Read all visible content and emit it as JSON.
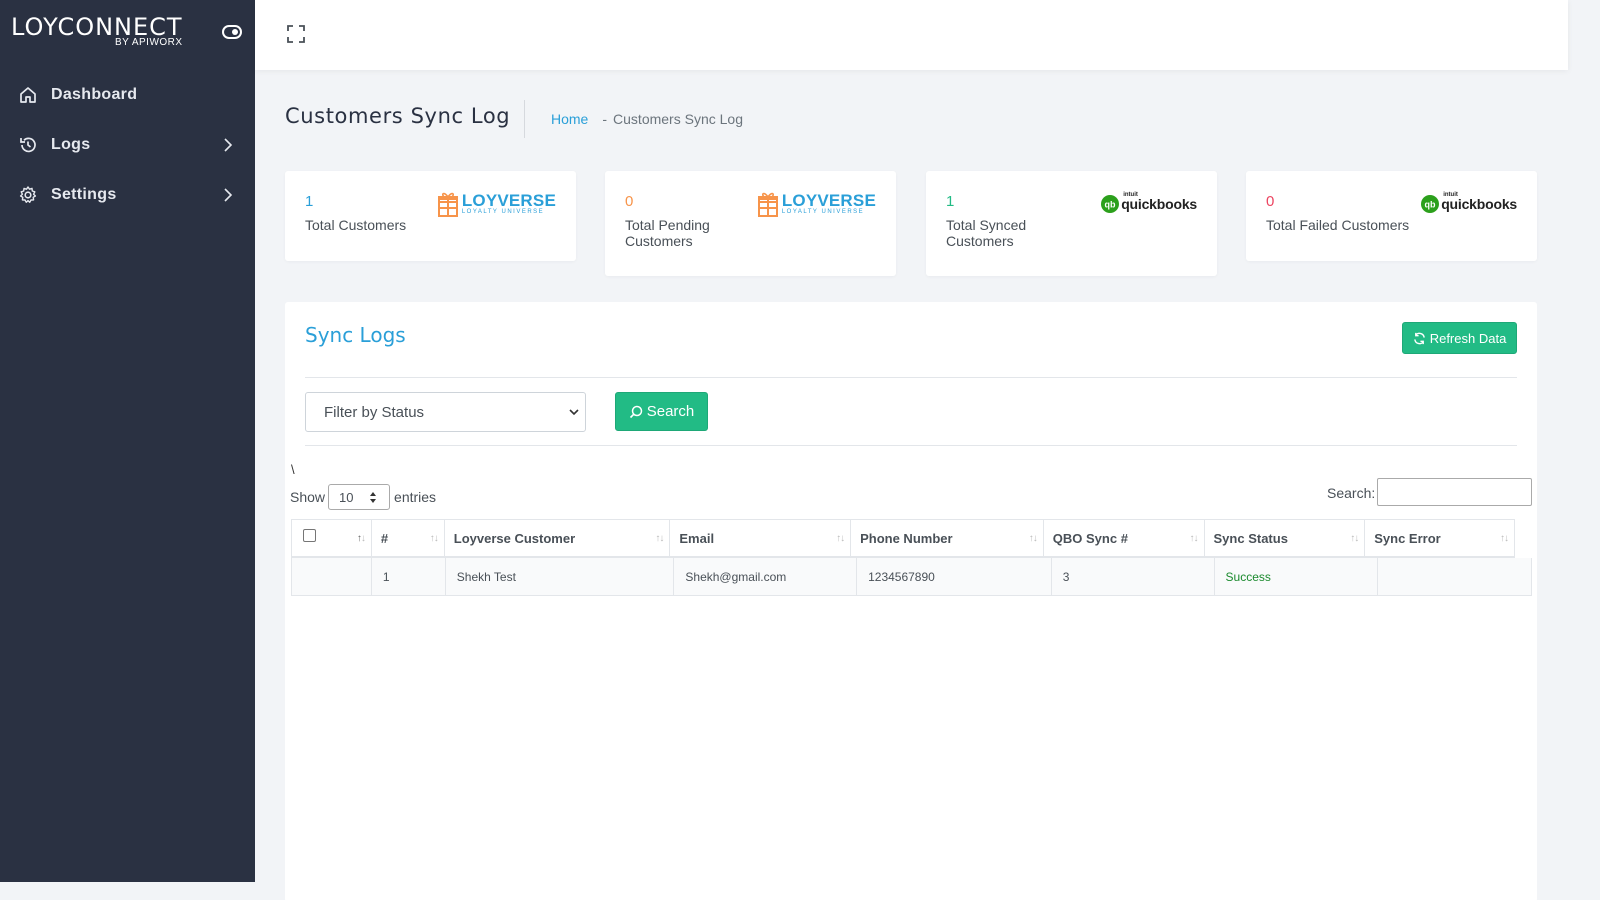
{
  "brand": {
    "name": "LOYCONNECT",
    "sub": "BY APIWORX"
  },
  "sidebar": {
    "items": [
      {
        "label": "Dashboard",
        "icon": "home-icon"
      },
      {
        "label": "Logs",
        "icon": "history-icon"
      },
      {
        "label": "Settings",
        "icon": "gear-icon"
      }
    ]
  },
  "page": {
    "title": "Customers Sync Log",
    "breadcrumb": {
      "home": "Home",
      "separator": "-",
      "current": "Customers Sync Log"
    }
  },
  "stats": [
    {
      "value": "1",
      "label": "Total Customers",
      "color": "#2a9fd8",
      "logo": "loyverse"
    },
    {
      "value": "0",
      "label": "Total Pending Customers",
      "color": "#f7944a",
      "logo": "loyverse"
    },
    {
      "value": "1",
      "label": "Total Synced Customers",
      "color": "#22bb85",
      "logo": "quickbooks"
    },
    {
      "value": "0",
      "label": "Total Failed Customers",
      "color": "#ec4561",
      "logo": "quickbooks"
    }
  ],
  "logos": {
    "loyverse": {
      "name": "LOYVERSE",
      "tagline": "LOYALTY UNIVERSE"
    },
    "quickbooks": {
      "name": "quickbooks",
      "prefix": "intuit",
      "mark": "qb"
    }
  },
  "panel": {
    "title": "Sync Logs",
    "refresh_label": "Refresh Data",
    "filter_placeholder": "Filter by Status",
    "search_label": "Search"
  },
  "table_controls": {
    "stray_text": "\\",
    "show_label": "Show",
    "entries_value": "10",
    "entries_label": "entries",
    "search_label": "Search:"
  },
  "table": {
    "columns": [
      "",
      "#",
      "Loyverse Customer",
      "Email",
      "Phone Number",
      "QBO Sync #",
      "Sync Status",
      "Sync Error"
    ],
    "rows": [
      {
        "num": "1",
        "customer": "Shekh Test",
        "email": "Shekh@gmail.com",
        "phone": "1234567890",
        "qbo_sync": "3",
        "status": "Success",
        "error": ""
      }
    ]
  },
  "colors": {
    "sidebar_bg": "#2a3142",
    "accent_blue": "#2a9fd8",
    "success_green": "#22bb85"
  }
}
